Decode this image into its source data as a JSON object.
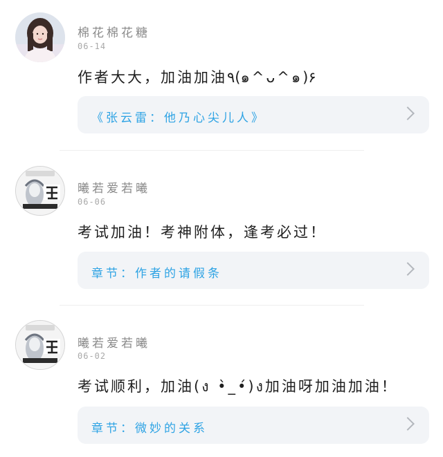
{
  "comments": [
    {
      "username": "棉花棉花糖",
      "date": "06-14",
      "text": "作者大大，加油加油٩(๑^ᴗ^๑)۶",
      "chapter": "《张云雷：他乃心尖儿人》",
      "avatar": "girl-photo"
    },
    {
      "username": "曦若爱若曦",
      "date": "06-06",
      "text": "考试加油！考神附体，逢考必过！",
      "chapter": "章节：作者的请假条",
      "avatar": "zhao-badge"
    },
    {
      "username": "曦若爱若曦",
      "date": "06-02",
      "text": "考试顺利，加油(ง •̀_•́)ง加油呀加油加油！",
      "chapter": "章节：微妙的关系",
      "avatar": "zhao-badge"
    }
  ],
  "icons": {
    "chevron": "chevron-right-icon"
  },
  "colors": {
    "chapter_link": "#2ea3e4",
    "card_bg": "#f2f4f7"
  }
}
